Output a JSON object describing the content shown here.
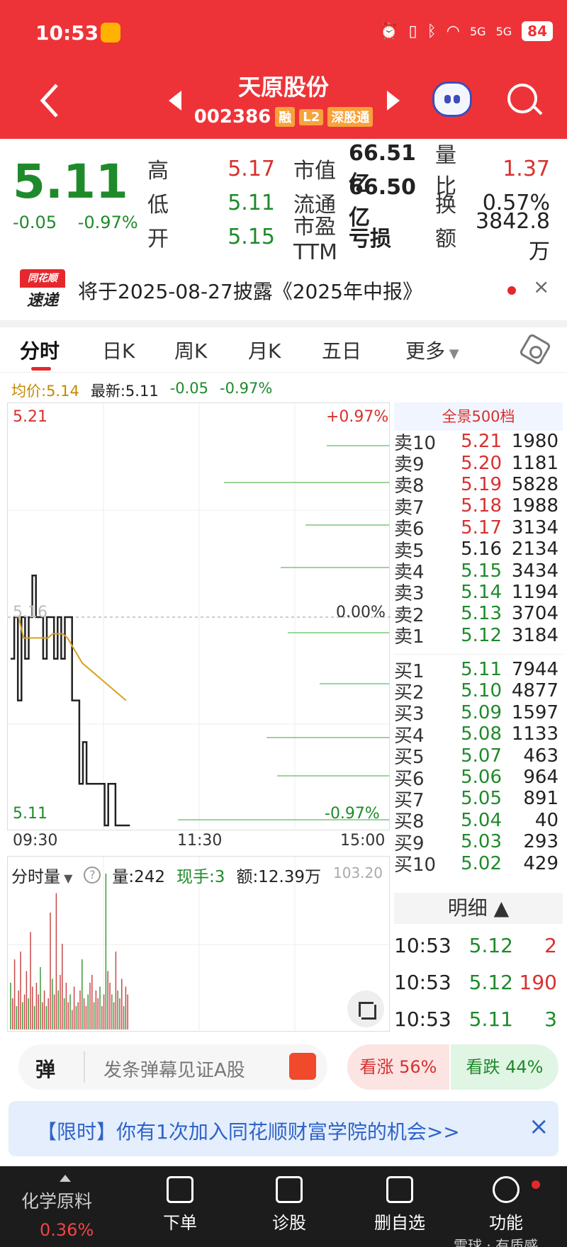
{
  "status": {
    "time": "10:53",
    "battery": "84",
    "signal1": "5G",
    "signal2": "5G"
  },
  "header": {
    "title": "天原股份",
    "code": "002386",
    "tags": [
      "融",
      "L2",
      "深股通"
    ]
  },
  "quote": {
    "price": "5.11",
    "change": "-0.05",
    "change_pct": "-0.97%",
    "rows": [
      {
        "l1": "高",
        "v1": "5.17",
        "c1": "red",
        "l2": "市值",
        "v2": "66.51亿",
        "l3": "量比",
        "v3": "1.37",
        "c3": "red"
      },
      {
        "l1": "低",
        "v1": "5.11",
        "c1": "green",
        "l2": "流通",
        "v2": "66.50亿",
        "l3": "换",
        "v3": "0.57%",
        "c3": "dark"
      },
      {
        "l1": "开",
        "v1": "5.15",
        "c1": "green",
        "l2": "市盈TTM",
        "v2": "亏损",
        "l3": "额",
        "v3": "3842.8万",
        "c3": "dark"
      }
    ]
  },
  "news": {
    "logo_top": "同花顺",
    "logo_bottom": "速递",
    "text": "将于2025-08-27披露《2025年中报》",
    "close": "×"
  },
  "tabs": [
    "分时",
    "日K",
    "周K",
    "月K",
    "五日",
    "更多"
  ],
  "info": {
    "avg": "均价:5.14",
    "latest": "最新:5.11",
    "chg": "-0.05",
    "pct": "-0.97%"
  },
  "chart_data": {
    "type": "line",
    "price_high": "5.21",
    "price_low": "5.11",
    "pre_close": "5.16",
    "pct_high": "+0.97%",
    "pct_zero": "0.00%",
    "pct_low": "-0.97%",
    "x_ticks": [
      "09:30",
      "11:30",
      "15:00"
    ],
    "series": [
      {
        "values": [
          5.15,
          5.16,
          5.14,
          5.16,
          5.15,
          5.16,
          5.17,
          5.16,
          5.16,
          5.15,
          5.16,
          5.16,
          5.15,
          5.16,
          5.15,
          5.16,
          5.16,
          5.14,
          5.14,
          5.12,
          5.13,
          5.12,
          5.12,
          5.12,
          5.12,
          5.12,
          5.11,
          5.12,
          5.12,
          5.11,
          5.11,
          5.11,
          5.11,
          5.11
        ]
      },
      {
        "values": [
          5.16,
          5.155,
          5.155,
          5.155,
          5.155,
          5.155,
          5.155,
          5.156,
          5.156,
          5.156,
          5.155,
          5.153,
          5.151,
          5.149,
          5.148,
          5.147,
          5.146,
          5.145,
          5.144,
          5.143,
          5.142,
          5.141,
          5.14
        ]
      }
    ],
    "ylim": [
      5.11,
      5.21
    ]
  },
  "volume": {
    "selector": "分时量",
    "help": "?",
    "vol": "量:242",
    "hand": "现手:3",
    "amount": "额:12.39万",
    "ref": "103.20",
    "bars": [
      12,
      8,
      18,
      6,
      10,
      20,
      7,
      9,
      15,
      8,
      25,
      11,
      6,
      12,
      9,
      16,
      7,
      10,
      6,
      8,
      30,
      13,
      9,
      35,
      10,
      14,
      22,
      8,
      12,
      7,
      9,
      5,
      11,
      6,
      7,
      10,
      18,
      8,
      6,
      9,
      12,
      14,
      7,
      10,
      8,
      11,
      6,
      9,
      40,
      15,
      12,
      9,
      7,
      20,
      10,
      8,
      13,
      6,
      11,
      9
    ]
  },
  "book": {
    "title": "全景500档",
    "asks": [
      {
        "l": "卖10",
        "p": "5.21",
        "c": "red",
        "v": "1980"
      },
      {
        "l": "卖9",
        "p": "5.20",
        "c": "red",
        "v": "1181"
      },
      {
        "l": "卖8",
        "p": "5.19",
        "c": "red",
        "v": "5828"
      },
      {
        "l": "卖7",
        "p": "5.18",
        "c": "red",
        "v": "1988"
      },
      {
        "l": "卖6",
        "p": "5.17",
        "c": "red",
        "v": "3134"
      },
      {
        "l": "卖5",
        "p": "5.16",
        "c": "dark",
        "v": "2134"
      },
      {
        "l": "卖4",
        "p": "5.15",
        "c": "green",
        "v": "3434"
      },
      {
        "l": "卖3",
        "p": "5.14",
        "c": "green",
        "v": "1194"
      },
      {
        "l": "卖2",
        "p": "5.13",
        "c": "green",
        "v": "3704"
      },
      {
        "l": "卖1",
        "p": "5.12",
        "c": "green",
        "v": "3184"
      }
    ],
    "bids": [
      {
        "l": "买1",
        "p": "5.11",
        "c": "green",
        "v": "7944"
      },
      {
        "l": "买2",
        "p": "5.10",
        "c": "green",
        "v": "4877"
      },
      {
        "l": "买3",
        "p": "5.09",
        "c": "green",
        "v": "1597"
      },
      {
        "l": "买4",
        "p": "5.08",
        "c": "green",
        "v": "1133"
      },
      {
        "l": "买5",
        "p": "5.07",
        "c": "green",
        "v": "463"
      },
      {
        "l": "买6",
        "p": "5.06",
        "c": "green",
        "v": "964"
      },
      {
        "l": "买7",
        "p": "5.05",
        "c": "green",
        "v": "891"
      },
      {
        "l": "买8",
        "p": "5.04",
        "c": "green",
        "v": "40"
      },
      {
        "l": "买9",
        "p": "5.03",
        "c": "green",
        "v": "293"
      },
      {
        "l": "买10",
        "p": "5.02",
        "c": "green",
        "v": "429"
      }
    ]
  },
  "detail": {
    "title": "明细 ▲",
    "rows": [
      {
        "t": "10:53",
        "p": "5.12",
        "pc": "green",
        "n": "2",
        "nc": "red"
      },
      {
        "t": "10:53",
        "p": "5.12",
        "pc": "green",
        "n": "190",
        "nc": "red"
      },
      {
        "t": "10:53",
        "p": "5.11",
        "pc": "green",
        "n": "3",
        "nc": "green"
      }
    ]
  },
  "danmu": {
    "label": "弹",
    "placeholder": "发条弹幕见证A股"
  },
  "vote": {
    "up": "看涨 56%",
    "down": "看跌 44%"
  },
  "promo": {
    "text": "【限时】你有1次加入同花顺财富学院的机会>>",
    "close": "×"
  },
  "nav": {
    "sector": "化学原料",
    "sector_chg": "0.36%",
    "items": [
      "下单",
      "诊股",
      "删自选",
      "功能"
    ]
  },
  "watermark": "雪球 · 有质感"
}
